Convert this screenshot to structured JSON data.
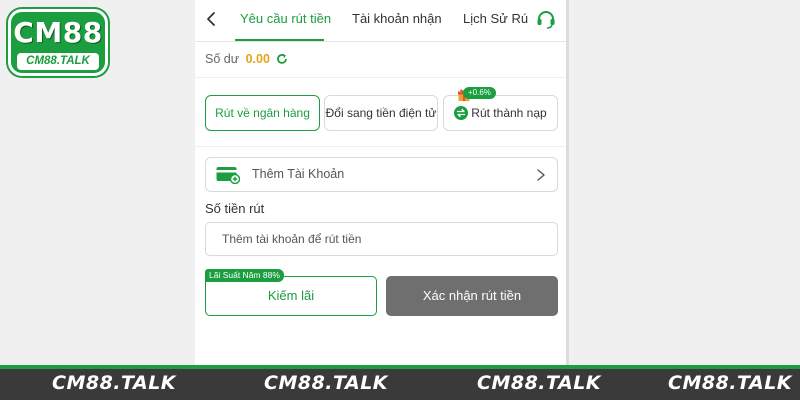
{
  "logo": {
    "main": "CM88",
    "sub": "CM88.TALK"
  },
  "header": {
    "tabs": [
      {
        "label": "Yêu cầu rút tiền",
        "active": true
      },
      {
        "label": "Tài khoản nhận",
        "active": false
      },
      {
        "label": "Lịch Sử Rú",
        "active": false
      }
    ],
    "back_icon": "chevron-left-icon",
    "support_icon": "headset-icon"
  },
  "balance": {
    "label": "Số dư",
    "value": "0.00"
  },
  "withdraw_options": [
    {
      "label": "Rút về ngân hàng",
      "active": true
    },
    {
      "label": "Đổi sang tiền điện tử",
      "active": false
    },
    {
      "label": "Rút thành nạp",
      "active": false,
      "badge": "+0.6%"
    }
  ],
  "add_account": {
    "label": "Thêm Tài Khoản"
  },
  "amount": {
    "label": "Số tiền rút",
    "placeholder": "Thêm tài khoản để rút tiền"
  },
  "actions": {
    "interest_badge": "Lãi Suất Năm 88%",
    "interest_label": "Kiếm lãi",
    "confirm_label": "Xác nhận rút tiền"
  },
  "footer": {
    "brands": [
      "CM88.TALK",
      "CM88.TALK",
      "CM88.TALK",
      "CM88.TALK"
    ]
  },
  "colors": {
    "accent": "#1a9e3f",
    "balance": "#e8a317",
    "confirm_bg": "#6f6f6f",
    "footer_bg": "#3a3a3a"
  }
}
